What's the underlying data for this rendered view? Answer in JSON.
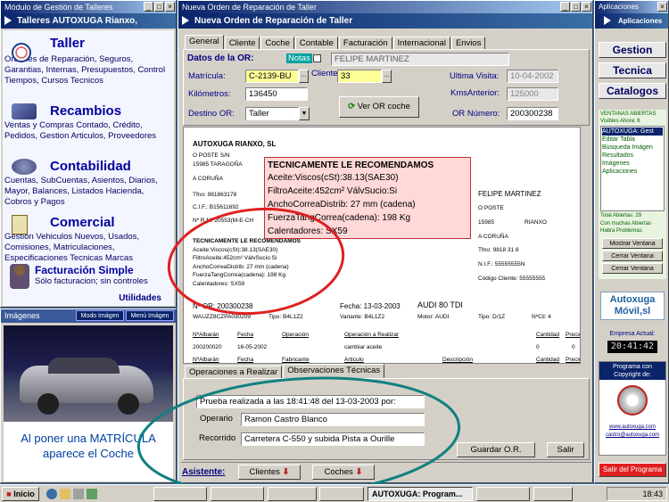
{
  "left_window": {
    "title": "Módulo de Gestión de Talleres",
    "header": "Talleres AUTOXUGA Rianxo,",
    "sections": [
      {
        "title": "Taller",
        "text": "Ordenes de Reparación, Seguros, Garantias, Internas, Presupuestos, Control Tiempos, Cursos Tecnicos"
      },
      {
        "title": "Recambios",
        "text": "Ventas y Compras Contado, Crédito, Pedidos, Gestion Articulos, Proveedores"
      },
      {
        "title": "Contabilidad",
        "text": "Cuentas, SubCuentas, Asientos, Diarios, Mayor, Balances, Listados Hacienda, Cobros y Pagos"
      },
      {
        "title": "Comercial",
        "text": "Gestion Vehiculos Nuevos, Usados, Comisiones, Matriculaciones, Especificaciones Tecnicas Marcas"
      },
      {
        "title": "Facturación Simple",
        "text": "Sólo facturacion; sin controles"
      }
    ],
    "utilidades": "Utilidades",
    "images_label": "Imágenes",
    "mode_btn": "Modo Imágen",
    "menu_btn": "Menú Imágen",
    "car_caption": "Al poner una MATRÍCULA aparece el Coche"
  },
  "main_window": {
    "title": "Nueva Orden de Reparación de Taller",
    "header": "Nueva Orden de Reparación de Taller",
    "tabs": [
      "General",
      "Cliente",
      "Coche",
      "Contable",
      "Facturación",
      "Internacional",
      "Envios"
    ],
    "datos_label": "Datos de la OR:",
    "notas_label": "Notas",
    "client_name": "FELIPE MARTINEZ",
    "matricula_label": "Matrícula:",
    "matricula_value": "C-2139-BU",
    "cliente_label": "Cliente",
    "cliente_value": "33",
    "ultima_label": "Ultima Visita:",
    "ultima_value": "10-04-2002",
    "km_label": "Kilómetros:",
    "km_value": "136450",
    "kmsant_label": "KmsAnterior:",
    "kmsant_value": "125000",
    "destino_label": "Destino OR:",
    "destino_value": "Taller",
    "ver_or_btn": "Ver OR coche",
    "or_num_label": "OR Número:",
    "or_num_value": "200300238",
    "bottom_tabs": [
      "Operaciones a Realizar",
      "Observaciones Técnicas"
    ],
    "prueba_text": "Prueba realizada a las 18:41:48 del 13-03-2003 por:",
    "operario_label": "Operario",
    "operario_value": "Ramon Castro Blanco",
    "recorrido_label": "Recorrido",
    "recorrido_value": "Carretera C-550 y subida  Pista a Ourille",
    "guardar_btn": "Guardar O.R.",
    "salir_btn": "Salir",
    "asistente_label": "Asistente:",
    "clientes_btn": "Clientes",
    "coches_btn": "Coches"
  },
  "doc": {
    "company": "AUTOXUGA RIANXO, SL",
    "addr1": "O POSTE S/N",
    "addr2": "15985 TARAGOÑA",
    "addr3": "A CORUÑA",
    "tfno": "Tfno: 981863178",
    "cif": "C.I.F.: B15611692",
    "nrm": "Nº R.M. 20553(M-E-CH",
    "client": "FELIPE MARTINEZ",
    "c_addr1": "O POSTE",
    "c_cp": "15985",
    "c_city": "RIANXO",
    "c_prov": "A CORUÑA",
    "c_tfno": "Tfno:  9818  31  8",
    "c_nif": "N.I.F.: 55555555N",
    "c_code": "Código Cliente: 55555555",
    "rec_title": "TECNICAMENTE LE RECOMENDAMOS",
    "rec_lines": [
      "Aceite:Viscos(cSt):38.13(SAE30)",
      "FiltroAceite:452cm²  VálvSucio:Si",
      "AnchoCorreaDistrib: 27 mm   (cadena)",
      "FuerzaTangCorrea(cadena):  198 Kg",
      "Calentadores:   SX59"
    ],
    "or_label": "Nº OR: 200300238",
    "fecha": "Fecha:  13-03-2003",
    "model": "AUDI 80 TDI",
    "vin": "WAUZZ8CZPA030209",
    "tipo": "Tipo: B4L1Z2",
    "variante": "Variante: B4L1Z2",
    "motor": "Motor: AUDI",
    "tipo2": "Tipo: D/1Z",
    "ncil": "NºCil: 4",
    "cols1": [
      "NºAlbarán",
      "Fecha",
      "Operación",
      "Operación a Realizar",
      "Cantidad",
      "Precio"
    ],
    "row1": [
      "200200020",
      "16-05-2002",
      "",
      "cambiar aceite",
      "0",
      "0"
    ],
    "cols2": [
      "NºAlbarán",
      "Fecha",
      "Fabricante",
      "Articulo",
      "Descripción",
      "Cantidad",
      "Precio"
    ]
  },
  "popup": {
    "title": "TECNICAMENTE LE RECOMENDAMOS",
    "lines": [
      "Aceite:Viscos(cSt):38.13(SAE30)",
      "FiltroAceite:452cm²  VálvSucio:Si",
      "AnchoCorreaDistrib: 27 mm   (cadena)",
      "FuerzaTangCorrea(cadena):  198 Kg",
      "Calentadores:   SX59"
    ]
  },
  "right_window": {
    "title": "Aplicaciones",
    "header": "Aplicaciones",
    "buttons": [
      "Gestion",
      "Tecnica",
      "Catalogos"
    ],
    "ventanas_title": "VENTANAS ABIERTAS",
    "visibles": "Visibles Ahora: 6",
    "list": [
      "AUTOXUGA: Gest",
      "Editar Tabla",
      "Búsqueda Imágen",
      "Resultados",
      "Imágenes",
      "Aplicaciones"
    ],
    "total": "Total Abiertas: 29",
    "muchas": "Con muchas Abiertas Habra Problemas",
    "small_btns": [
      "Mostrar Ventana",
      "Cerrar Ventana",
      "Cerrar Ventana"
    ],
    "logo": "Autoxuga Móvil,sl",
    "empresa": "Empresa Actual:",
    "clock": "20:41:42",
    "prog_text": "Programa con Copyright de:",
    "url1": "www.autoxuga.com",
    "url2": "castro@autoxuga.com",
    "salir_btn": "Salir del Programa"
  },
  "taskbar": {
    "start": "Inicio",
    "task_app": "AUTOXUGA: Program...",
    "time": "18:43"
  },
  "colors": {
    "accent_red": "#e02020",
    "accent_teal": "#108080",
    "title_blue": "#0a246a"
  }
}
